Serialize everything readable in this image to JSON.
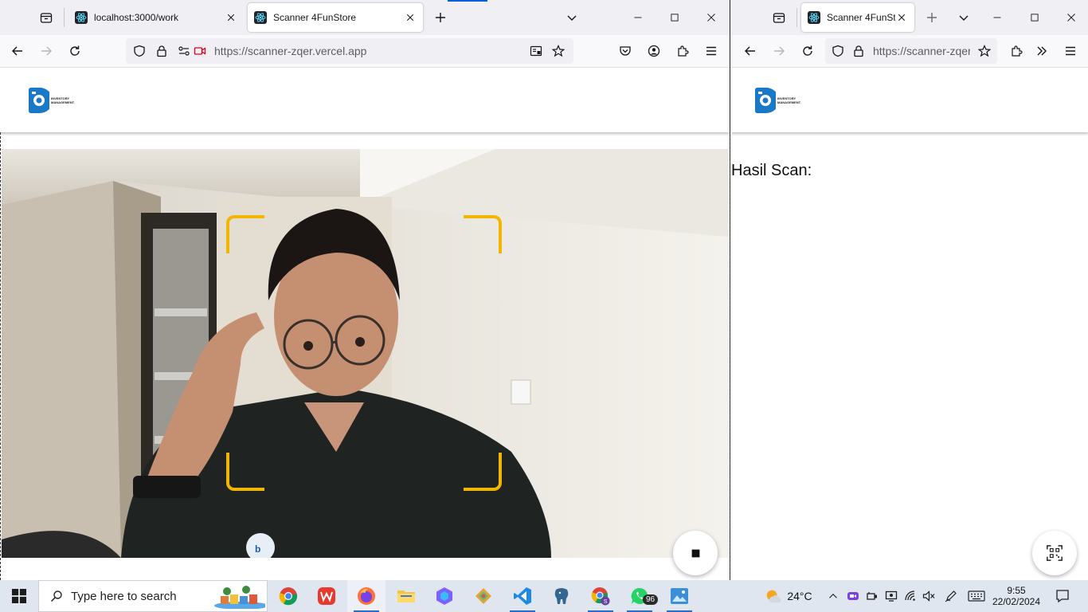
{
  "left_window": {
    "tabs": [
      {
        "title": "localhost:3000/work",
        "active": false
      },
      {
        "title": "Scanner 4FunStore",
        "active": true
      }
    ],
    "url": "https://scanner-zqer.vercel.app"
  },
  "right_window": {
    "tabs": [
      {
        "title": "Scanner 4FunStore",
        "active": true
      }
    ],
    "url": "https://scanner-zqer.vercel.app"
  },
  "app": {
    "logo_text": "INVENTORY MANAGEMENT.",
    "result_label": "Hasil Scan:"
  },
  "taskbar": {
    "search_placeholder": "Type here to search",
    "weather_temp": "24°C",
    "whatsapp_badge": "96",
    "time": "9:55",
    "date": "22/02/2024"
  },
  "colors": {
    "accent_bracket": "#f2b600",
    "logo_blue": "#1a78c8",
    "tab_active": "#ffffff",
    "tabstrip": "#f0f0f4"
  }
}
